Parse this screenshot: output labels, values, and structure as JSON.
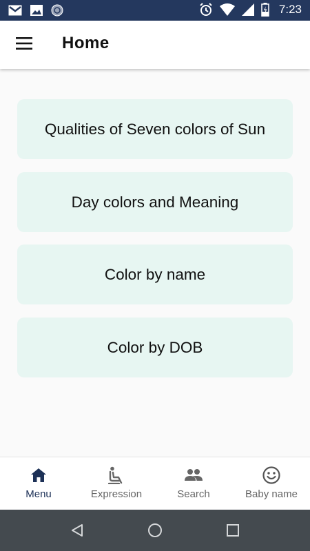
{
  "status_bar": {
    "time": "7:23",
    "left_icons": [
      "gmail-icon",
      "image-icon",
      "sync-icon"
    ],
    "right_icons": [
      "alarm-icon",
      "wifi-icon",
      "signal-icon",
      "battery-icon"
    ]
  },
  "app_bar": {
    "title": "Home",
    "menu_icon": "hamburger-menu-icon"
  },
  "cards": [
    {
      "label": "Qualities of Seven colors of Sun"
    },
    {
      "label": "Day colors and Meaning"
    },
    {
      "label": "Color by name"
    },
    {
      "label": "Color by DOB"
    }
  ],
  "bottom_nav": {
    "items": [
      {
        "label": "Menu",
        "icon": "home-icon",
        "active": true
      },
      {
        "label": "Expression",
        "icon": "seat-icon",
        "active": false
      },
      {
        "label": "Search",
        "icon": "people-icon",
        "active": false
      },
      {
        "label": "Baby name",
        "icon": "smiley-icon",
        "active": false
      }
    ]
  },
  "system_nav": {
    "buttons": [
      "back-icon",
      "home-circle-icon",
      "recents-icon"
    ]
  },
  "colors": {
    "status_bar": "#24385e",
    "card_background": "#e7f6f2",
    "active_nav": "#1d3157",
    "inactive_nav": "#666666",
    "system_nav": "#444a4f"
  }
}
